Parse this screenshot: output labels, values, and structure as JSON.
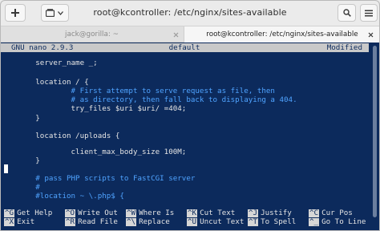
{
  "window": {
    "title": "root@kcontroller: /etc/nginx/sites-available"
  },
  "headerbar": {
    "new_tab_icon": "plus-icon",
    "tabs_menu_icon": "tabs-overview-icon",
    "search_icon": "search-icon",
    "menu_icon": "hamburger-menu-icon"
  },
  "tabs": [
    {
      "label": "jack@gorilla: ~",
      "active": false
    },
    {
      "label": "root@kcontroller: /etc/nginx/sites-available",
      "active": true
    }
  ],
  "nano": {
    "version": "GNU nano 2.9.3",
    "filename": "default",
    "status": "Modified",
    "lines": [
      "        server_name _;",
      "",
      "        location / {",
      "                # First attempt to serve request as file, then",
      "                # as directory, then fall back to displaying a 404.",
      "                try_files $uri $uri/ =404;",
      "        }",
      "",
      "        location /uploads {",
      "",
      "                client_max_body_size 100M;",
      "",
      "        }",
      "",
      "        # pass PHP scripts to FastCGI server",
      "        #",
      "        #location ~ \\.php$ {"
    ],
    "shortcuts_row1": [
      {
        "key": "^G",
        "label": "Get Help"
      },
      {
        "key": "^O",
        "label": "Write Out"
      },
      {
        "key": "^W",
        "label": "Where Is"
      },
      {
        "key": "^K",
        "label": "Cut Text"
      },
      {
        "key": "^J",
        "label": "Justify"
      },
      {
        "key": "^C",
        "label": "Cur Pos"
      }
    ],
    "shortcuts_row2": [
      {
        "key": "^X",
        "label": "Exit"
      },
      {
        "key": "^R",
        "label": "Read File"
      },
      {
        "key": "^\\",
        "label": "Replace"
      },
      {
        "key": "^U",
        "label": "Uncut Text"
      },
      {
        "key": "^T",
        "label": "To Spell"
      },
      {
        "key": "^_",
        "label": "Go To Line"
      }
    ]
  },
  "colors": {
    "terminal_bg": "#0c2a5c",
    "terminal_fg": "#e4e4e4",
    "comment": "#4fa3ff",
    "titlebar_bg": "#c9c9c9"
  }
}
